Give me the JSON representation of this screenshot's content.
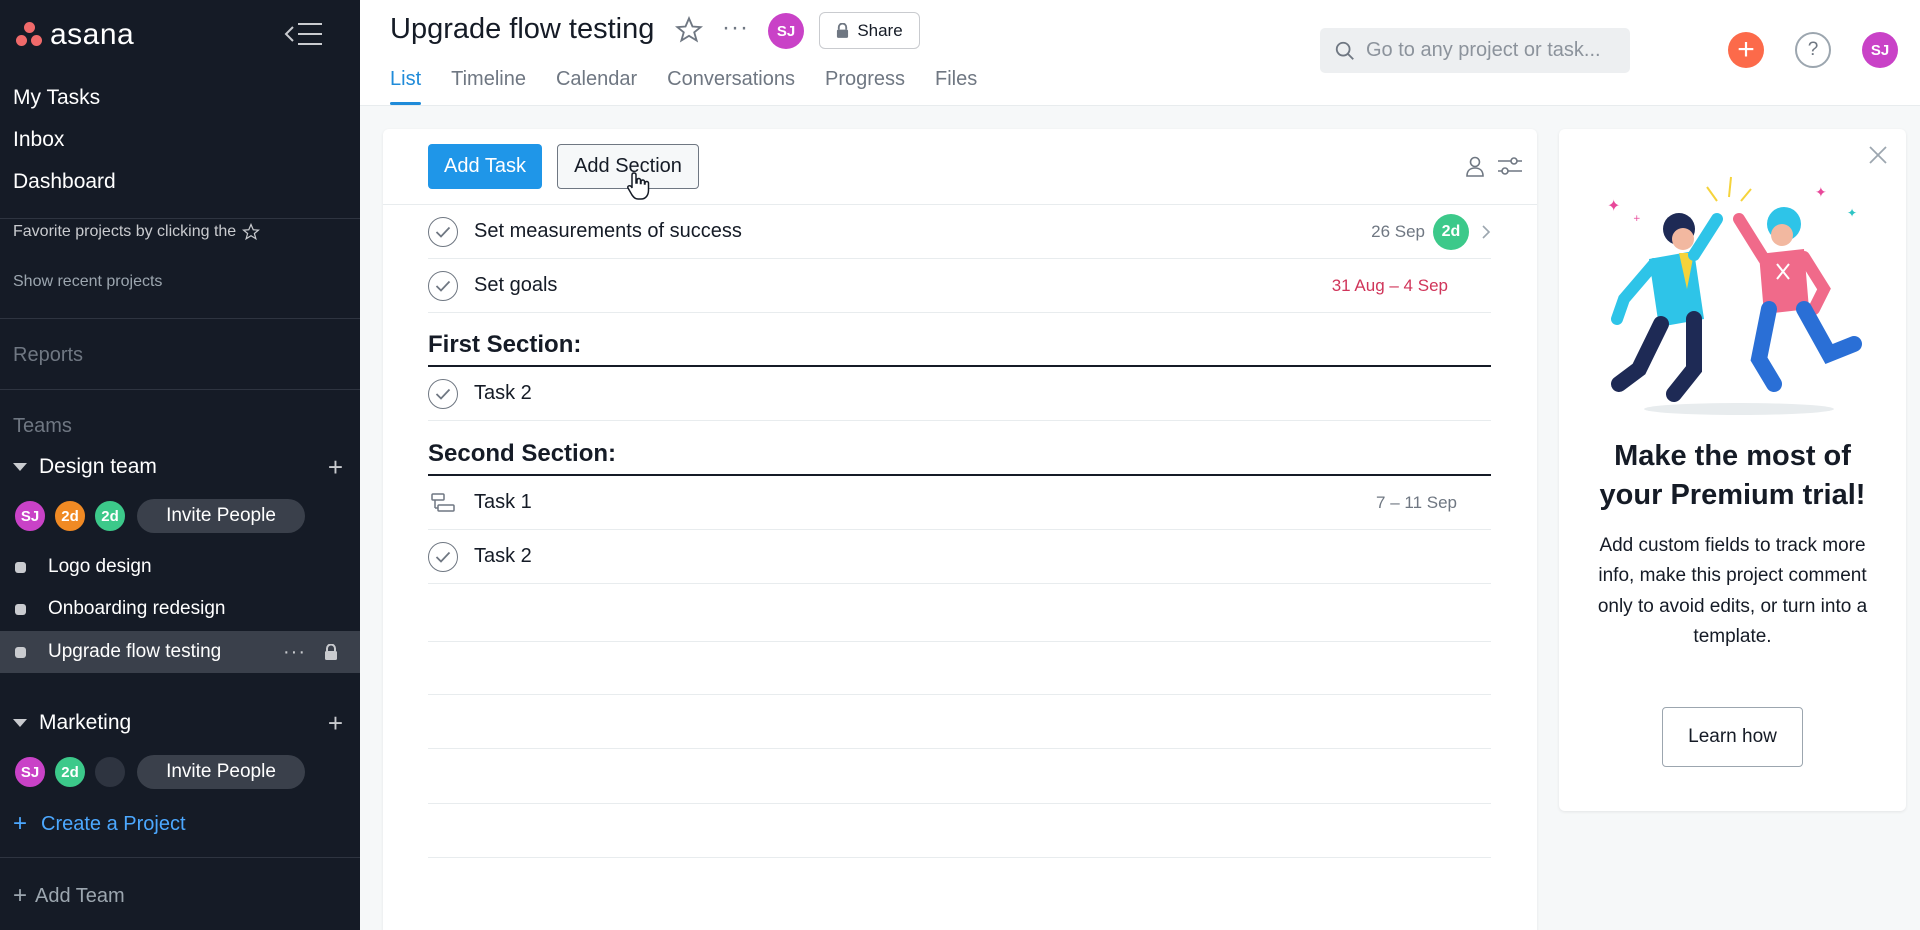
{
  "brand": {
    "name": "asana",
    "accent": "#f06a6a"
  },
  "sidebar": {
    "nav": [
      "My Tasks",
      "Inbox",
      "Dashboard"
    ],
    "favorites_hint": "Favorite projects by clicking the",
    "recent_label": "Show recent projects",
    "reports_label": "Reports",
    "teams_label": "Teams",
    "teams": [
      {
        "name": "Design team",
        "members": [
          {
            "initials": "SJ",
            "color": "#c942c7"
          },
          {
            "initials": "2d",
            "color": "#f08a24"
          },
          {
            "initials": "2d",
            "color": "#3cc98a"
          }
        ],
        "invite_label": "Invite People",
        "projects": [
          "Logo design",
          "Onboarding redesign",
          "Upgrade flow testing"
        ]
      },
      {
        "name": "Marketing",
        "members": [
          {
            "initials": "SJ",
            "color": "#c942c7"
          },
          {
            "initials": "2d",
            "color": "#3cc98a"
          },
          {
            "initials": "",
            "color": "#2e3440"
          }
        ],
        "invite_label": "Invite People"
      }
    ],
    "create_project": "Create a Project",
    "add_team": "Add Team"
  },
  "header": {
    "title": "Upgrade flow testing",
    "avatar": "SJ",
    "share_label": "Share",
    "tabs": [
      "List",
      "Timeline",
      "Calendar",
      "Conversations",
      "Progress",
      "Files"
    ],
    "active_tab": "List",
    "search_placeholder": "Go to any project or task...",
    "help_label": "?",
    "user_initials": "SJ"
  },
  "toolbar": {
    "add_task": "Add Task",
    "add_section": "Add Section"
  },
  "tasks": [
    {
      "name": "Set measurements of success",
      "due": "26 Sep",
      "assignee": "2d"
    },
    {
      "name": "Set goals",
      "due": "31 Aug – 4 Sep"
    }
  ],
  "sections": [
    {
      "title": "First Section:",
      "tasks": [
        {
          "name": "Task 2"
        }
      ]
    },
    {
      "title": "Second Section:",
      "tasks": [
        {
          "name": "Task 1",
          "due": "7 – 11 Sep"
        },
        {
          "name": "Task 2"
        }
      ]
    }
  ],
  "promo": {
    "title": "Make the most of your Premium trial!",
    "body": "Add custom fields to track more info, make this project comment only to avoid edits, or turn into a template.",
    "button": "Learn how"
  }
}
